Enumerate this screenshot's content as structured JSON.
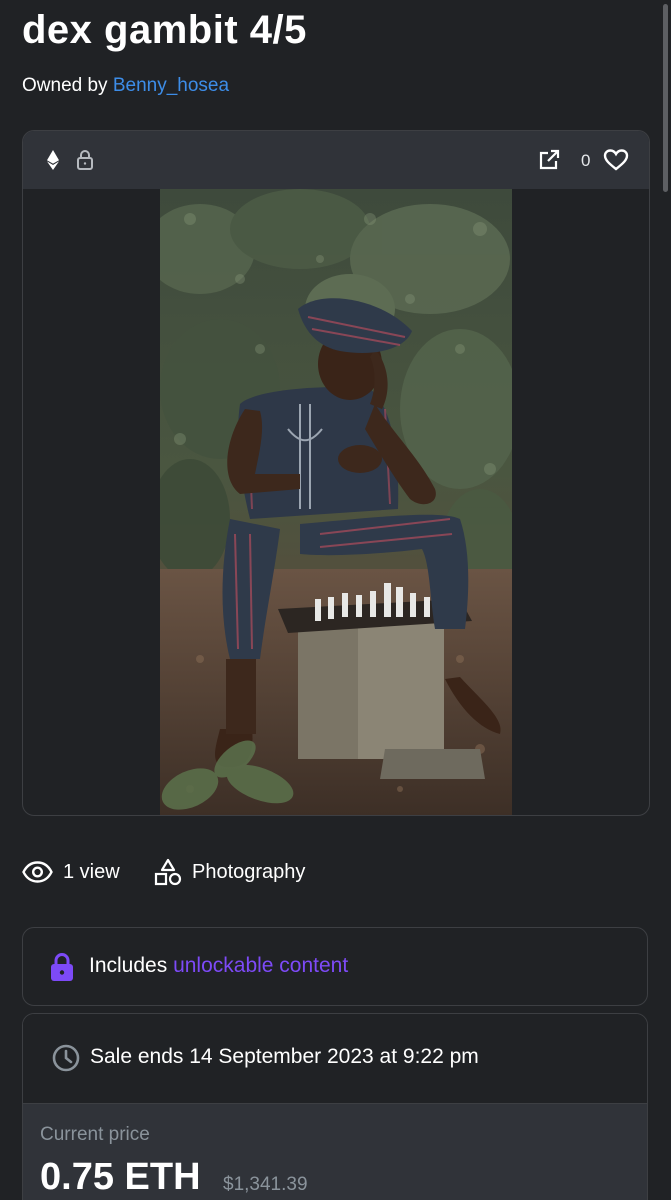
{
  "item": {
    "title": "dex gambit 4/5",
    "owned_by_label": "Owned by",
    "owner_name": "Benny_hosea"
  },
  "media": {
    "chain_icon": "ethereum-icon",
    "lock_icon": "lock-icon",
    "open_icon": "external-link-icon",
    "favorite_icon": "heart-icon",
    "favorite_count": "0"
  },
  "stats": {
    "views_icon": "eye-icon",
    "views_text": "1 view",
    "category_icon": "shapes-icon",
    "category_text": "Photography"
  },
  "unlockable": {
    "icon": "lock-icon",
    "prefix": "Includes",
    "link_text": "unlockable content"
  },
  "sale": {
    "clock_icon": "clock-icon",
    "ends_text": "Sale ends 14 September 2023 at 9:22 pm",
    "price_label": "Current price",
    "price": "0.75 ETH",
    "price_usd": "$1,341.39"
  },
  "colors": {
    "background": "#202225",
    "panel": "#303339",
    "border": "#3d3f43",
    "link_blue": "#3d8de8",
    "accent_purple": "#7d4af7",
    "muted_text": "#8a939b"
  }
}
